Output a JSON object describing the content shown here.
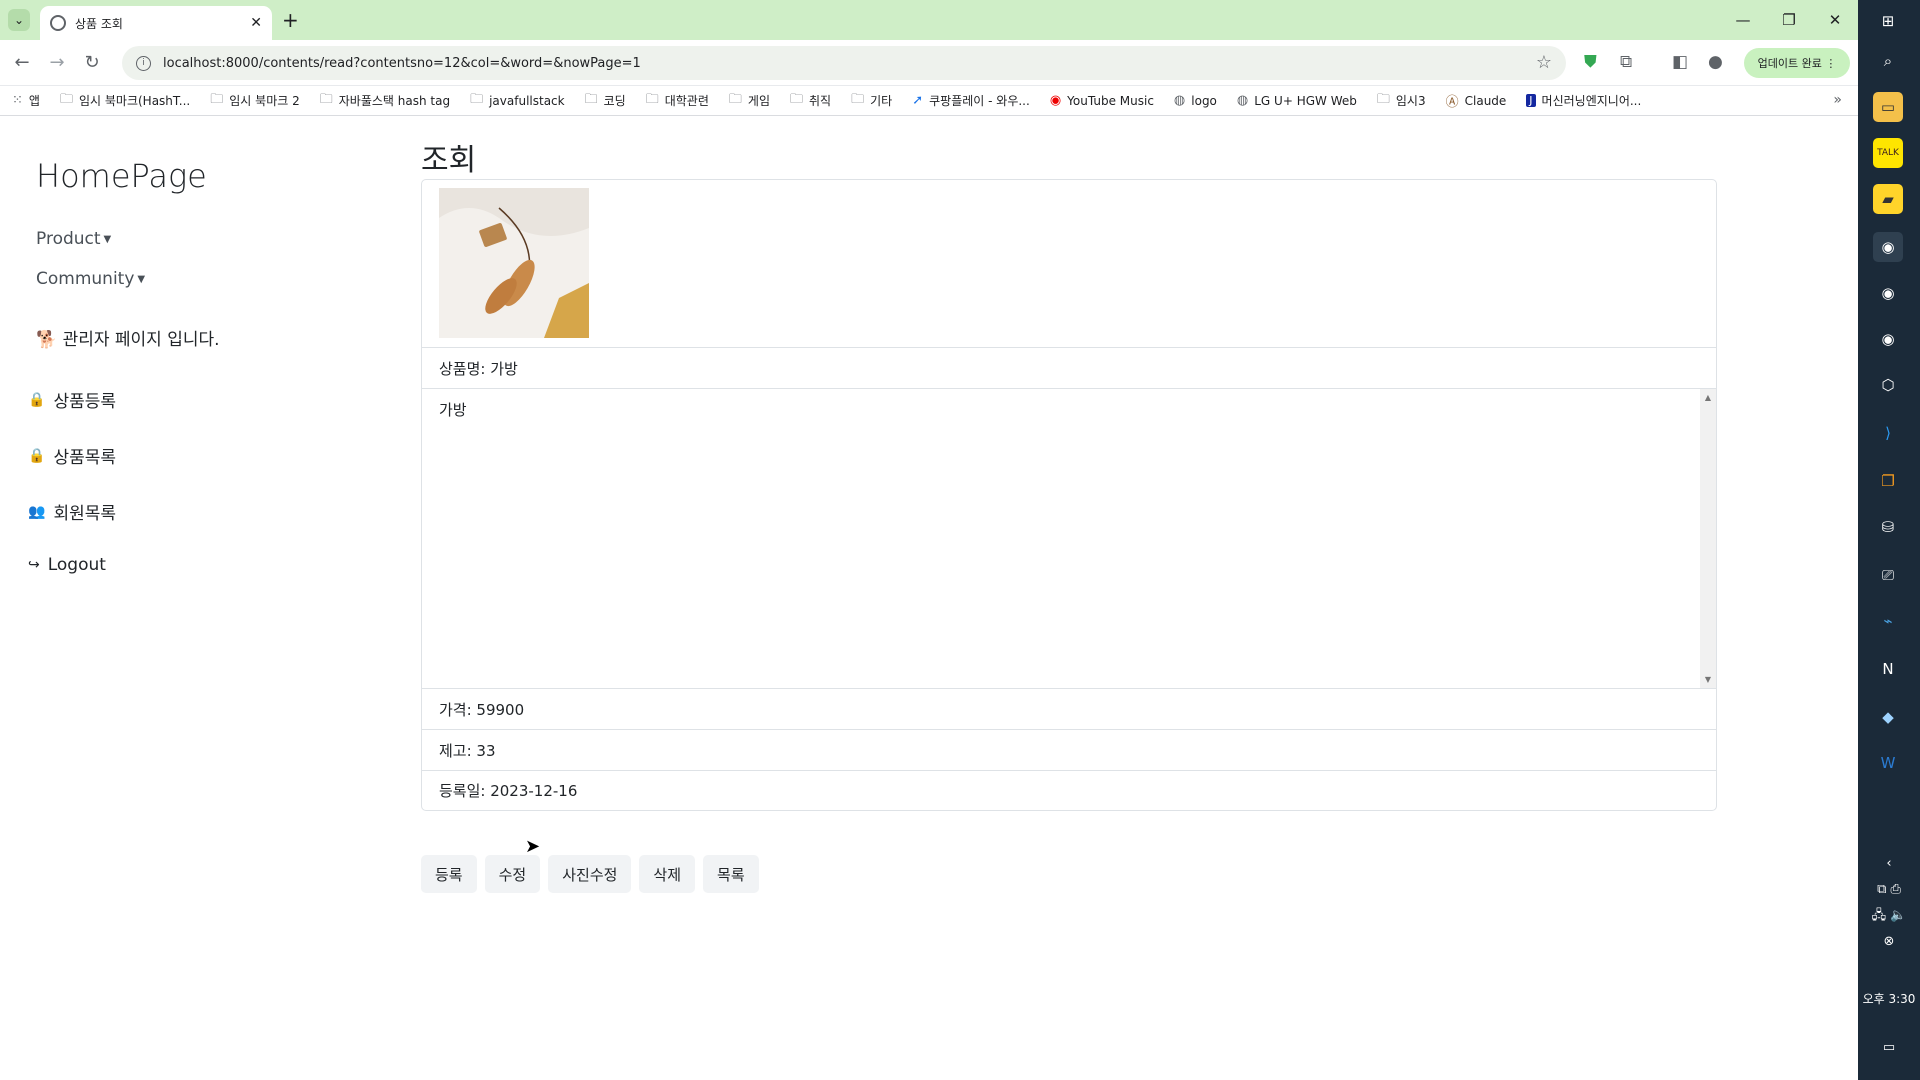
{
  "browser": {
    "tab_title": "상품 조회",
    "url": "localhost:8000/contents/read?contentsno=12&col=&word=&nowPage=1",
    "update_label": "업데이트 완료",
    "bookmarks": [
      "앱",
      "임시 북마크(HashT...",
      "임시 북마크 2",
      "자바풀스택 hash tag",
      "javafullstack",
      "코딩",
      "대학관련",
      "게임",
      "취직",
      "기타",
      "쿠팡플레이 - 와우...",
      "YouTube Music",
      "logo",
      "LG U+ HGW Web",
      "임시3",
      "Claude",
      "머신러닝엔지니어..."
    ]
  },
  "sidebar": {
    "brand": "HomePage",
    "product_label": "Product",
    "community_label": "Community",
    "admin_text": "관리자 페이지 입니다.",
    "items": [
      {
        "label": "상품등록"
      },
      {
        "label": "상품목록"
      },
      {
        "label": "회원목록"
      },
      {
        "label": "Logout"
      }
    ]
  },
  "main": {
    "heading": "조회",
    "product_name": "상품명: 가방",
    "description": "가방",
    "price": "가격: 59900",
    "stock": "제고: 33",
    "reg_date": "등록일: 2023-12-16",
    "buttons": {
      "create": "등록",
      "edit": "수정",
      "edit_photo": "사진수정",
      "delete": "삭제",
      "list": "목록"
    }
  },
  "taskbar": {
    "clock": "오후 3:30"
  },
  "colors": {
    "tabstrip": "#cfeec7",
    "taskbar": "#1b2a39"
  }
}
